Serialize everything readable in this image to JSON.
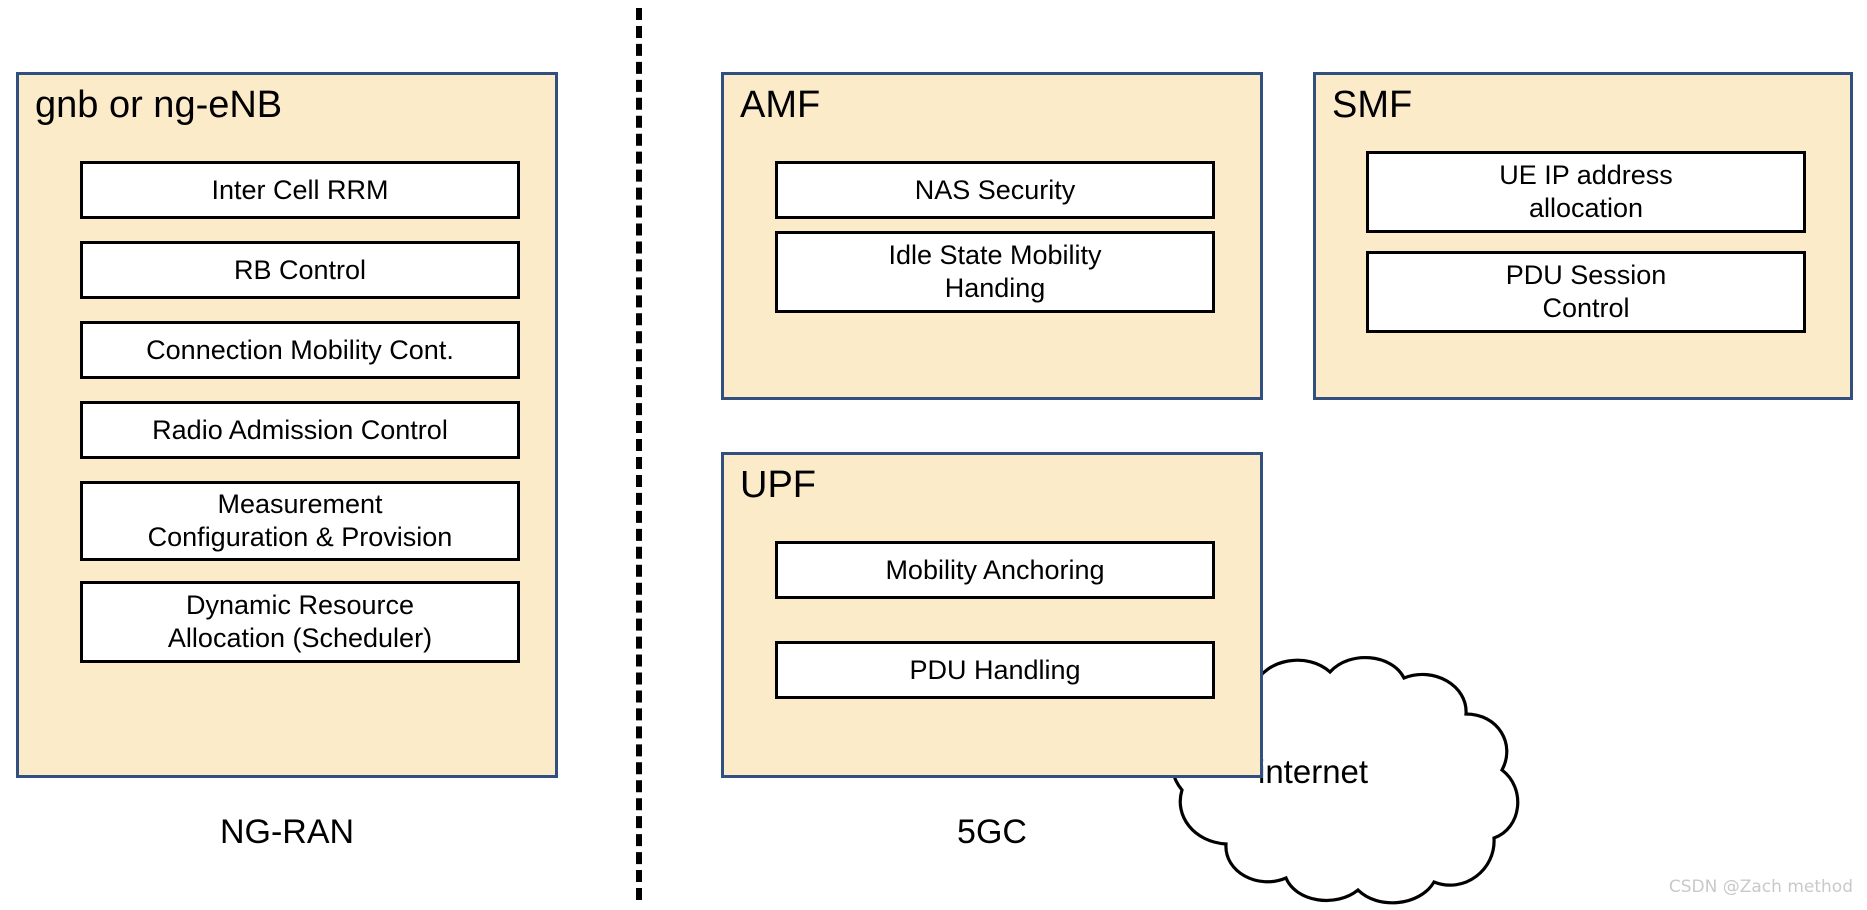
{
  "colors": {
    "nf_fill": "#FCEBC8",
    "nf_border": "#31507F",
    "fn_fill": "#FFFFFF",
    "fn_border": "#000000",
    "text": "#000000",
    "watermark": "#C9C9C9",
    "divider": "#000000"
  },
  "divider": {
    "style": "dashed-vertical"
  },
  "groups": {
    "left_caption": "NG-RAN",
    "right_caption": "5GC"
  },
  "ran": {
    "title": "gnb or ng-eNB",
    "functions": [
      {
        "label": "Inter Cell RRM"
      },
      {
        "label": "RB Control"
      },
      {
        "label": "Connection Mobility Cont."
      },
      {
        "label": "Radio Admission Control"
      },
      {
        "label": "Measurement\nConfiguration & Provision"
      },
      {
        "label": "Dynamic Resource\nAllocation (Scheduler)"
      }
    ]
  },
  "amf": {
    "title": "AMF",
    "functions": [
      {
        "label": "NAS Security"
      },
      {
        "label": "Idle State Mobility\nHanding"
      }
    ]
  },
  "smf": {
    "title": "SMF",
    "functions": [
      {
        "label": "UE IP address\nallocation"
      },
      {
        "label": "PDU Session\nControl"
      }
    ]
  },
  "upf": {
    "title": "UPF",
    "functions": [
      {
        "label": "Mobility Anchoring"
      },
      {
        "label": "PDU Handling"
      }
    ]
  },
  "cloud": {
    "label": "internet",
    "icon": "cloud-icon"
  },
  "watermark": {
    "text": "CSDN @Zach method"
  }
}
